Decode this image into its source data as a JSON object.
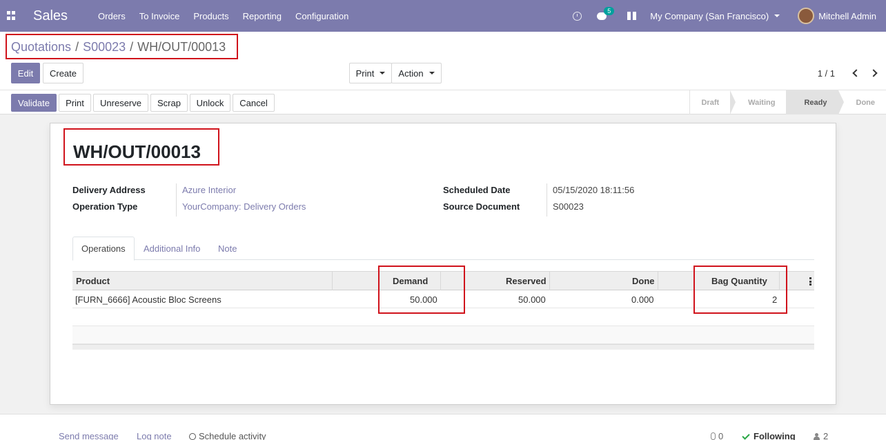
{
  "navbar": {
    "app_name": "Sales",
    "menu": [
      "Orders",
      "To Invoice",
      "Products",
      "Reporting",
      "Configuration"
    ],
    "chat_count": "5",
    "company": "My Company (San Francisco)",
    "user": "Mitchell Admin"
  },
  "breadcrumb": [
    "Quotations",
    "S00023",
    "WH/OUT/00013"
  ],
  "control": {
    "edit": "Edit",
    "create": "Create",
    "print": "Print",
    "action": "Action",
    "pager": "1 / 1"
  },
  "statusbar": {
    "buttons": [
      "Validate",
      "Print",
      "Unreserve",
      "Scrap",
      "Unlock",
      "Cancel"
    ],
    "stages": [
      "Draft",
      "Waiting",
      "Ready",
      "Done"
    ],
    "current_stage": "Ready"
  },
  "form": {
    "title": "WH/OUT/00013",
    "delivery_address_label": "Delivery Address",
    "delivery_address": "Azure Interior",
    "operation_type_label": "Operation Type",
    "operation_type": "YourCompany: Delivery Orders",
    "scheduled_date_label": "Scheduled Date",
    "scheduled_date": "05/15/2020 18:11:56",
    "source_document_label": "Source Document",
    "source_document": "S00023",
    "tabs": [
      "Operations",
      "Additional Info",
      "Note"
    ],
    "table": {
      "headers": [
        "Product",
        "Demand",
        "Reserved",
        "Done",
        "Bag Quantity"
      ],
      "rows": [
        [
          "[FURN_6666] Acoustic Bloc Screens",
          "50.000",
          "50.000",
          "0.000",
          "2"
        ]
      ]
    }
  },
  "chatter": {
    "send_message": "Send message",
    "log_note": "Log note",
    "schedule_activity": "Schedule activity",
    "attachments": "0",
    "following": "Following",
    "followers": "2"
  },
  "colors": {
    "brand": "#7c7bad",
    "highlight": "#d0121b"
  }
}
